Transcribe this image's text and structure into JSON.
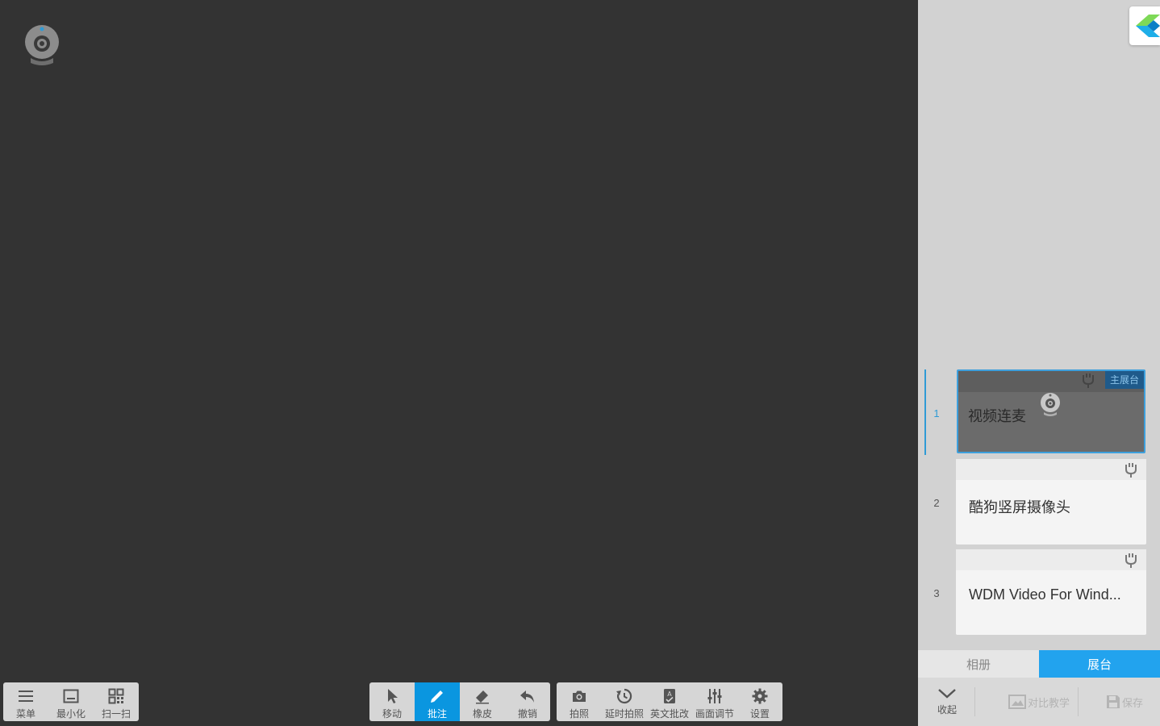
{
  "bottom_left": {
    "menu": "菜单",
    "minimize": "最小化",
    "scan": "扫一扫"
  },
  "bottom_center": {
    "move": "移动",
    "annotate": "批注",
    "eraser": "橡皮",
    "undo": "撤销",
    "active_tool": "annotate"
  },
  "bottom_right": {
    "photo": "拍照",
    "timed_photo": "延时拍照",
    "english_grading": "英文批改",
    "image_adjust": "画面调节",
    "settings": "设置"
  },
  "sources": [
    {
      "index": "1",
      "name": "视频连麦",
      "badge": "主展台",
      "active": true
    },
    {
      "index": "2",
      "name": "酷狗竖屏摄像头",
      "active": false
    },
    {
      "index": "3",
      "name": "WDM Video For Wind...",
      "active": false
    }
  ],
  "tabs": {
    "album": "相册",
    "stage": "展台",
    "active": "stage"
  },
  "side_footer": {
    "collapse": "收起",
    "compare": "对比教学",
    "save": "保存"
  },
  "colors": {
    "accent": "#0a96e0",
    "tab_active": "#22a3ee",
    "stage_bg": "#333333"
  }
}
